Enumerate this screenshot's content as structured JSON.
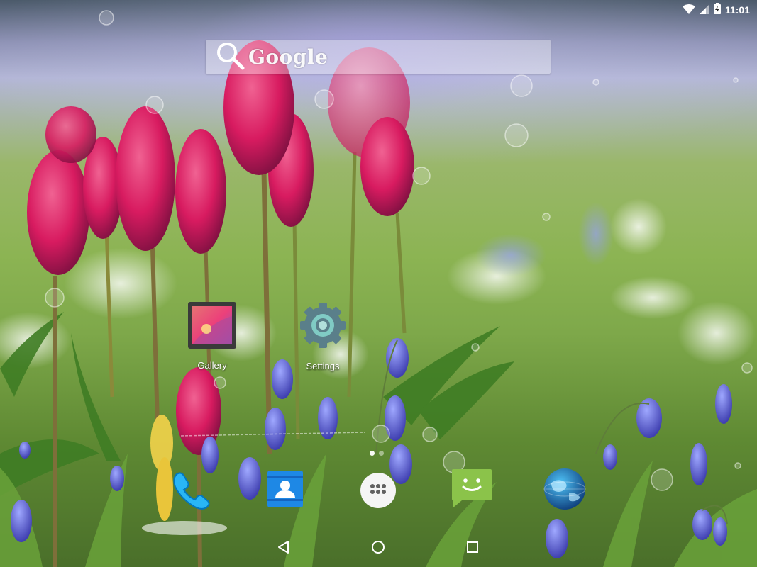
{
  "status_bar": {
    "time": "11:01",
    "icons": [
      "wifi-icon",
      "cellular-signal-icon",
      "battery-charging-icon"
    ]
  },
  "search": {
    "label": "Google",
    "icon": "search-icon"
  },
  "home_apps": [
    {
      "label": "Gallery",
      "icon": "gallery-icon"
    },
    {
      "label": "Settings",
      "icon": "settings-gear-icon"
    }
  ],
  "page_indicator": {
    "pages": 2,
    "current": 1
  },
  "dock": [
    {
      "icon": "phone-icon"
    },
    {
      "icon": "contacts-icon"
    },
    {
      "icon": "all-apps-icon"
    },
    {
      "icon": "messaging-icon"
    },
    {
      "icon": "browser-globe-icon"
    }
  ],
  "nav_bar": [
    "back-icon",
    "home-icon",
    "recents-icon"
  ],
  "colors": {
    "settings_gear": "#5a7f8a",
    "contacts_blue": "#1e88e5",
    "messaging_green": "#8bc34a",
    "phone_blue": "#29b6f6",
    "tulip_pink": "#d81b60"
  }
}
